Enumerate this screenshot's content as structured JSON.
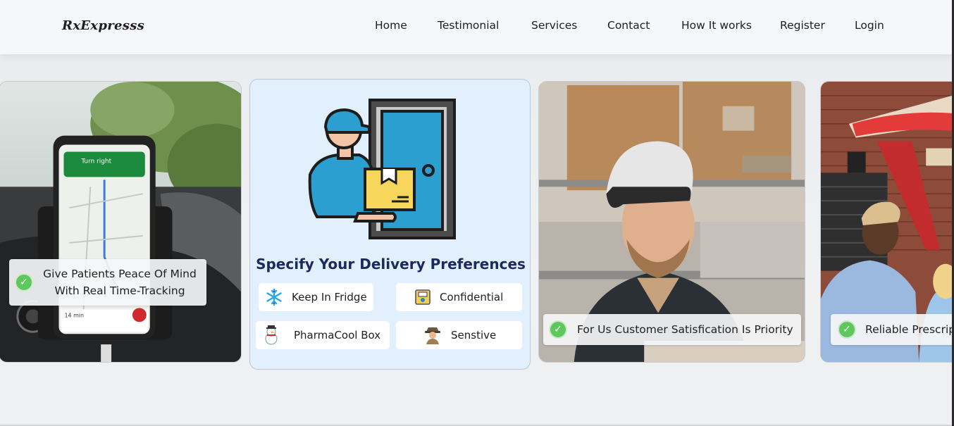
{
  "brand": {
    "logo_text": "RxExpresss"
  },
  "nav": {
    "items": [
      {
        "label": "Home"
      },
      {
        "label": "Testimonial"
      },
      {
        "label": "Services"
      },
      {
        "label": "Contact"
      },
      {
        "label": "How It works"
      },
      {
        "label": "Register"
      },
      {
        "label": "Login"
      }
    ]
  },
  "cards": {
    "tracking": {
      "caption_line1": "Give Patients Peace Of Mind",
      "caption_line2": "With Real Time-Tracking",
      "icon": "green-check-icon"
    },
    "preferences": {
      "title": "Specify Your Delivery Preferences",
      "options": [
        {
          "label": "Keep In Fridge",
          "icon": "snowflake-icon"
        },
        {
          "label": "Confidential",
          "icon": "confidential-box-icon"
        },
        {
          "label": "PharmaCool Box",
          "icon": "snowman-icon"
        },
        {
          "label": "Senstive",
          "icon": "detective-icon"
        }
      ]
    },
    "satisfaction": {
      "caption": "For Us Customer Satisfication Is Priority",
      "icon": "green-check-icon"
    },
    "reliable": {
      "caption": "Reliable Prescrip",
      "icon": "green-check-icon"
    }
  },
  "colors": {
    "accent_navy": "#1b2a5e",
    "pref_bg": "#e2f0fd",
    "check_green": "#5ec85e"
  }
}
